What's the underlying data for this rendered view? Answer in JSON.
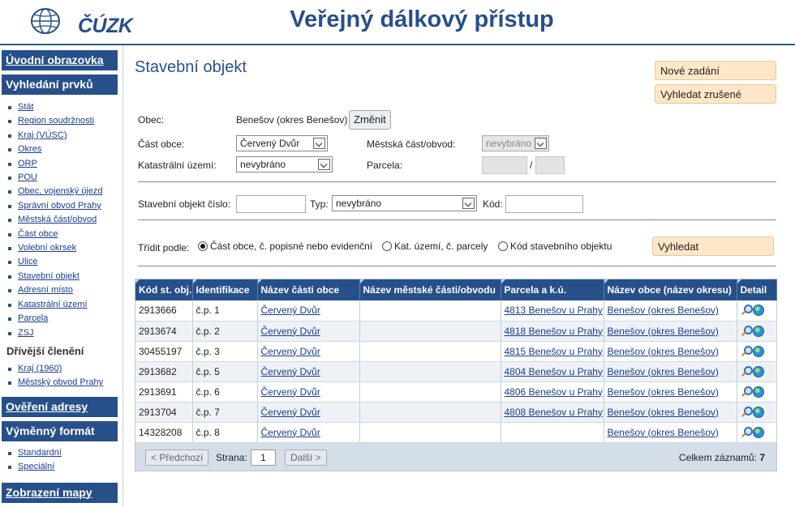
{
  "header": {
    "logo_text": "ČÚZK",
    "title": "Veřejný dálkový přístup"
  },
  "sidebar": {
    "home": "Úvodní obrazovka",
    "search_head": "Vyhledání prvků",
    "search_items": [
      "Stát",
      "Region soudržnosti",
      "Kraj (VÚSC)",
      "Okres",
      "ORP",
      "POU",
      "Obec, vojenský újezd",
      "Správní obvod Prahy",
      "Městská část/obvod",
      "Část obce",
      "Volební okrsek",
      "Ulice",
      "Stavební objekt",
      "Adresní místo",
      "Katastrální území",
      "Parcela",
      "ZSJ"
    ],
    "former_head": "Dřívější členění",
    "former_items": [
      "Kraj (1960)",
      "Městský obvod Prahy"
    ],
    "verify": "Ověření adresy",
    "exchange_head": "Výměnný formát",
    "exchange_items": [
      "Standardní",
      "Speciální"
    ],
    "map": "Zobrazení mapy"
  },
  "main": {
    "title": "Stavební objekt",
    "new_entry": "Nové zadání",
    "search_cancelled": "Vyhledat zrušené",
    "form": {
      "obec_label": "Obec:",
      "obec_value": "Benešov (okres Benešov)",
      "change_button": "Změnit",
      "cast_obce_label": "Část obce:",
      "cast_obce_value": "Červený Dvůr",
      "mestska_cast_label": "Městská část/obvod:",
      "mestska_cast_value": "nevybráno",
      "ku_label": "Katastrální území:",
      "ku_value": "nevybráno",
      "parcela_label": "Parcela:",
      "parcela_sep": "/",
      "so_cislo_label": "Stavební objekt číslo:",
      "typ_label": "Typ:",
      "typ_value": "nevybráno",
      "kod_label": "Kód:",
      "sort_label": "Třídit podle:",
      "sort_options": [
        "Část obce, č. popisné nebo evidenční",
        "Kat. území, č. parcely",
        "Kód stavebního objektu"
      ],
      "search_button": "Vyhledat"
    },
    "table": {
      "columns": [
        "Kód st. obj.",
        "Identifikace",
        "Název části obce",
        "Název městské části/obvodu",
        "Parcela a k.ú.",
        "Název obce (název okresu)",
        "Detail"
      ],
      "rows": [
        [
          "2913666",
          "č.p. 1",
          "Červený Dvůr",
          "",
          "4813 Benešov u Prahy",
          "Benešov (okres Benešov)"
        ],
        [
          "2913674",
          "č.p. 2",
          "Červený Dvůr",
          "",
          "4818 Benešov u Prahy",
          "Benešov (okres Benešov)"
        ],
        [
          "30455197",
          "č.p. 3",
          "Červený Dvůr",
          "",
          "4815 Benešov u Prahy",
          "Benešov (okres Benešov)"
        ],
        [
          "2913682",
          "č.p. 5",
          "Červený Dvůr",
          "",
          "4804 Benešov u Prahy",
          "Benešov (okres Benešov)"
        ],
        [
          "2913691",
          "č.p. 6",
          "Červený Dvůr",
          "",
          "4806 Benešov u Prahy",
          "Benešov (okres Benešov)"
        ],
        [
          "2913704",
          "č.p. 7",
          "Červený Dvůr",
          "",
          "4808 Benešov u Prahy",
          "Benešov (okres Benešov)"
        ],
        [
          "14328208",
          "č.p. 8",
          "Červený Dvůr",
          "",
          "",
          "Benešov (okres Benešov)"
        ]
      ]
    },
    "pager": {
      "prev": "< Předchozí",
      "page_label": "Strana:",
      "page_value": "1",
      "next": "Další >",
      "total_label": "Celkem záznamů:",
      "total_value": "7"
    }
  },
  "colors": {
    "brand": "#27508a",
    "button_orange": "#fde7c8"
  }
}
